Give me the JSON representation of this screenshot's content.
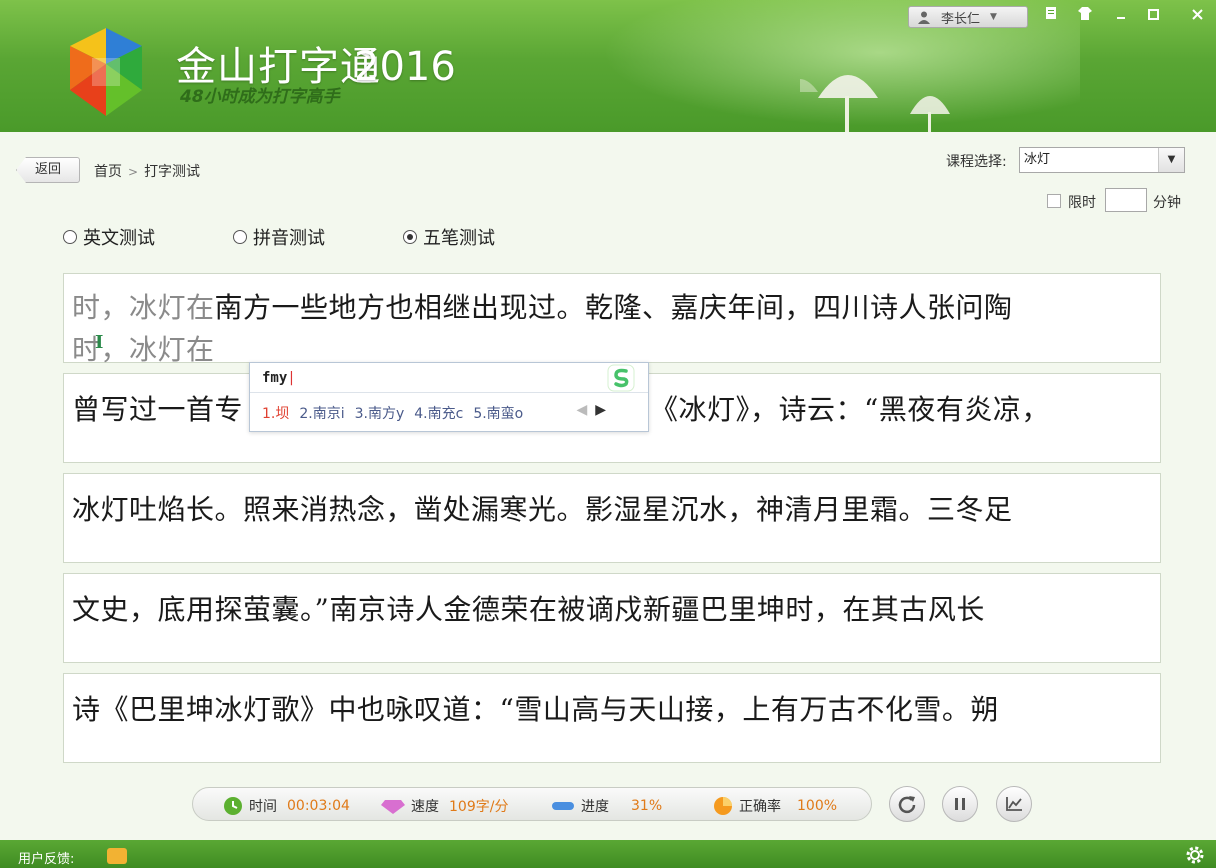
{
  "app": {
    "title": "金山打字通",
    "year": "2016",
    "subtitle": "48小时成为打字高手",
    "user_name": "李长仁"
  },
  "nav": {
    "back_label": "返回",
    "breadcrumb": [
      "首页",
      "打字测试"
    ],
    "separator": ">"
  },
  "course": {
    "label": "课程选择:",
    "selected": "冰灯"
  },
  "time_limit": {
    "label": "限时",
    "value": "",
    "unit": "分钟",
    "checked": false
  },
  "test_modes": [
    {
      "label": "英文测试",
      "checked": false
    },
    {
      "label": "拼音测试",
      "checked": false
    },
    {
      "label": "五笔测试",
      "checked": true
    }
  ],
  "passage": {
    "lines": [
      {
        "typed": "时，冰灯在",
        "rest": "南方一些地方也相继出现过。乾隆、嘉庆年间，四川诗人张问陶",
        "input": "时，冰灯在"
      },
      {
        "text": "曾写过一首专咏冰灯的诗，题目就叫《冰灯》，诗云：“黑夜有炎凉，"
      },
      {
        "text": "冰灯吐焰长。照来消热念，凿处漏寒光。影湿星沉水，神清月里霜。三冬足"
      },
      {
        "text": "文史，底用探萤囊。”南京诗人金德荣在被谪戍新疆巴里坤时，在其古风长"
      },
      {
        "text": "诗《巴里坤冰灯歌》中也咏叹道：“雪山高与天山接，上有万古不化雪。朔"
      }
    ],
    "line2_visible_prefix": "曾写过一首专",
    "line2_visible_suffix": "《冰灯》，诗云：“黑夜有炎凉，"
  },
  "ime": {
    "code": "fmy",
    "candidates": [
      "1.坝",
      "2.南京i",
      "3.南方y",
      "4.南充c",
      "5.南蛮o"
    ]
  },
  "stats": {
    "time_label": "时间",
    "time_value": "00:03:04",
    "speed_label": "速度",
    "speed_value": "109字/分",
    "progress_label": "进度",
    "progress_value": "31%",
    "accuracy_label": "正确率",
    "accuracy_value": "100%"
  },
  "footer": {
    "feedback_label": "用户反馈:"
  },
  "colors": {
    "header_green": "#5aa634",
    "stat_value": "#e07a18",
    "ime_highlight": "#e04030"
  }
}
